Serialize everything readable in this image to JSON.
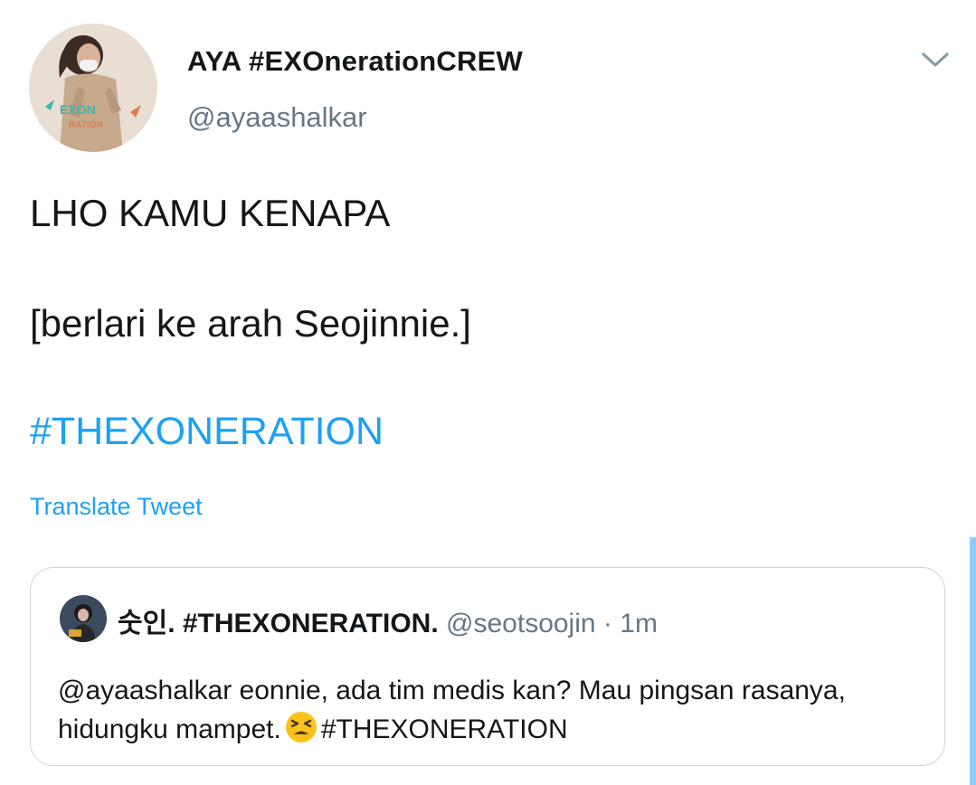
{
  "tweet": {
    "author": {
      "display_name": "AYA #EXOnerationCREW",
      "handle": "@ayaashalkar"
    },
    "menu_icon": "chevron-down-icon",
    "lines": [
      "LHO KAMU KENAPA",
      "[berlari ke arah Seojinnie.]"
    ],
    "hashtag": "#THEXONERATION",
    "translate_label": "Translate Tweet",
    "accent_color": "#1da1f2"
  },
  "quoted_tweet": {
    "display_name": "숫인. #THEXONERATION.",
    "handle": "@seotsoojin",
    "separator": "·",
    "time": "1m",
    "body_line1": "@ayaashalkar eonnie, ada tim medis kan? Mau pingsan rasanya,",
    "body_line2_text": "hidungku mampet.",
    "emoji": "tired-face-emoji",
    "body_hashtag": "#THEXONERATION"
  }
}
